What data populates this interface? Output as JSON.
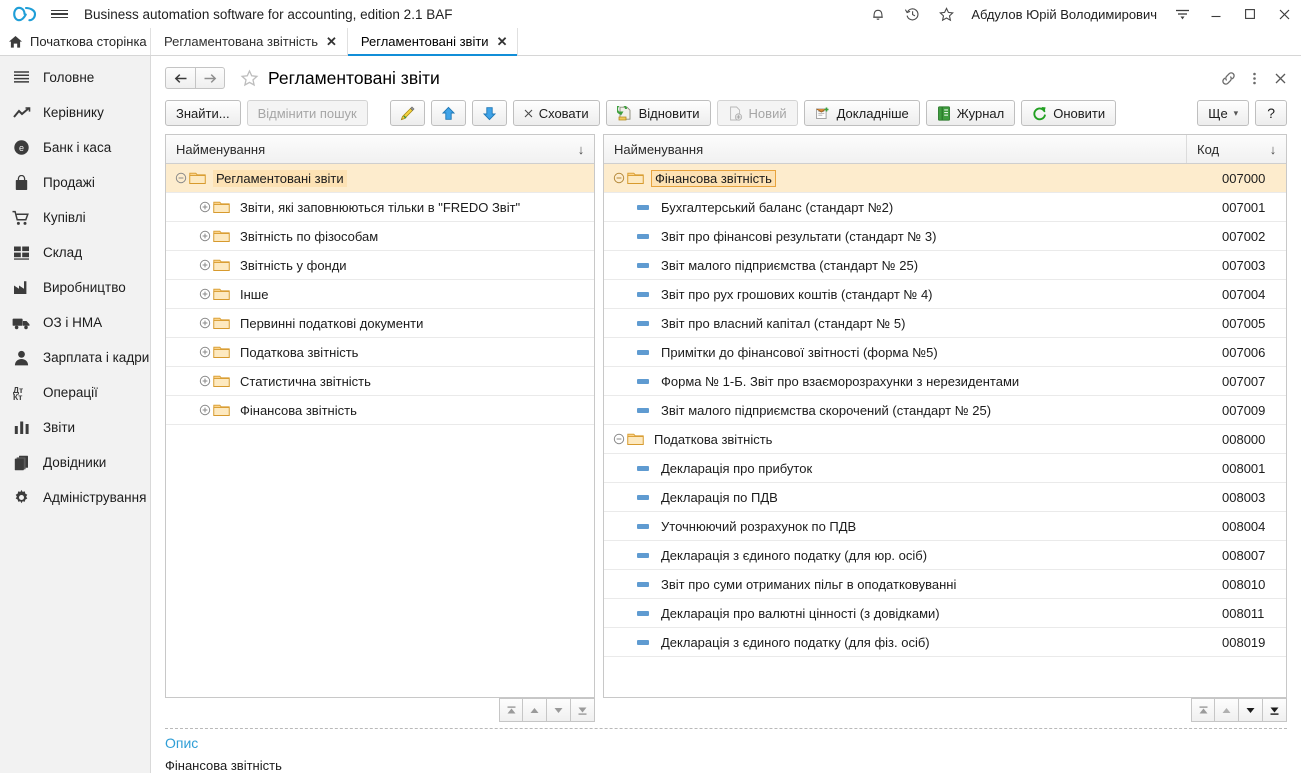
{
  "titlebar": {
    "logo_icon": "infinity-logo-icon",
    "menu_icon": "hamburger-menu-icon",
    "app_title": "Business automation software for accounting, edition 2.1 BAF",
    "notifications_icon": "bell-icon",
    "history_icon": "clock-history-icon",
    "favorites_icon": "star-icon",
    "user_name": "Абдулов Юрій Володимирович",
    "more_icon": "menu-lines-icon",
    "minimize_label": "—",
    "maximize_label": "□",
    "close_label": "✕"
  },
  "tabs": {
    "home_label": "Початкова сторінка",
    "home_icon": "home-icon",
    "items": [
      {
        "label": "Регламентована звітність",
        "active": false,
        "close": "✕"
      },
      {
        "label": "Регламентовані звіти",
        "active": true,
        "close": "✕"
      }
    ]
  },
  "sidebar": {
    "items": [
      {
        "label": "Головне",
        "icon": "lines-icon"
      },
      {
        "label": "Керівнику",
        "icon": "trend-line-icon"
      },
      {
        "label": "Банк і каса",
        "icon": "coin-icon"
      },
      {
        "label": "Продажі",
        "icon": "bag-icon"
      },
      {
        "label": "Купівлі",
        "icon": "shopping-cart-icon"
      },
      {
        "label": "Склад",
        "icon": "grid-blocks-icon"
      },
      {
        "label": "Виробництво",
        "icon": "factory-icon"
      },
      {
        "label": "ОЗ і НМА",
        "icon": "truck-icon"
      },
      {
        "label": "Зарплата і кадри",
        "icon": "person-icon"
      },
      {
        "label": "Операції",
        "icon": "debit-credit-icon"
      },
      {
        "label": "Звіти",
        "icon": "bar-chart-icon"
      },
      {
        "label": "Довідники",
        "icon": "books-icon"
      },
      {
        "label": "Адміністрування",
        "icon": "gear-icon"
      }
    ]
  },
  "form": {
    "back_icon": "arrow-left-icon",
    "forward_icon": "arrow-right-icon",
    "favorite_icon": "star-outline-icon",
    "title": "Регламентовані звіти",
    "link_icon": "link-icon",
    "kebab_icon": "vertical-dots-icon",
    "close_icon": "close-icon"
  },
  "commandbar": {
    "find_label": "Знайти...",
    "cancel_search_label": "Відмінити пошук",
    "edit_icon": "pencil-icon",
    "move_up_icon": "arrow-up-blue-icon",
    "move_down_icon": "arrow-down-blue-icon",
    "hide_label": "Сховати",
    "hide_icon": "close-small-icon",
    "restore_label": "Відновити",
    "restore_icon": "restore-icon",
    "new_label": "Новий",
    "new_icon": "new-document-icon",
    "details_label": "Докладніше",
    "details_icon": "details-document-icon",
    "journal_label": "Журнал",
    "journal_icon": "journal-book-icon",
    "refresh_label": "Оновити",
    "refresh_icon": "refresh-icon",
    "more_label": "Ще",
    "more_caret": "▾",
    "help_label": "?"
  },
  "left_panel": {
    "header_name": "Найменування",
    "sort_arrow": "↓",
    "rows": [
      {
        "label": "Регламентовані звіти",
        "level": 0,
        "node": "expanded",
        "type": "folder",
        "selected": true
      },
      {
        "label": "Звіти, які заповнюються тільки в \"FREDO Звіт\"",
        "level": 1,
        "node": "collapsed",
        "type": "folder",
        "selected": false
      },
      {
        "label": "Звітність по фізособам",
        "level": 1,
        "node": "collapsed",
        "type": "folder",
        "selected": false
      },
      {
        "label": "Звітність у фонди",
        "level": 1,
        "node": "collapsed",
        "type": "folder",
        "selected": false
      },
      {
        "label": "Інше",
        "level": 1,
        "node": "collapsed",
        "type": "folder",
        "selected": false
      },
      {
        "label": "Первинні податкові документи",
        "level": 1,
        "node": "collapsed",
        "type": "folder",
        "selected": false
      },
      {
        "label": "Податкова звітність",
        "level": 1,
        "node": "collapsed",
        "type": "folder",
        "selected": false
      },
      {
        "label": "Статистична звітність",
        "level": 1,
        "node": "collapsed",
        "type": "folder",
        "selected": false
      },
      {
        "label": "Фінансова звітність",
        "level": 1,
        "node": "collapsed",
        "type": "folder",
        "selected": false
      }
    ],
    "nav": [
      "first-icon",
      "up-icon",
      "down-icon",
      "last-icon"
    ]
  },
  "right_panel": {
    "header_name": "Найменування",
    "header_code": "Код",
    "sort_arrow": "↓",
    "rows": [
      {
        "label": "Фінансова звітність",
        "code": "007000",
        "level": 0,
        "node": "expanded",
        "type": "folder",
        "selected": true
      },
      {
        "label": "Бухгалтерський баланс (стандарт №2)",
        "code": "007001",
        "level": 1,
        "type": "item",
        "selected": false
      },
      {
        "label": "Звіт про фінансові результати (стандарт № 3)",
        "code": "007002",
        "level": 1,
        "type": "item",
        "selected": false
      },
      {
        "label": "Звіт малого підприємства (стандарт № 25)",
        "code": "007003",
        "level": 1,
        "type": "item",
        "selected": false
      },
      {
        "label": "Звіт про рух грошових коштів (стандарт № 4)",
        "code": "007004",
        "level": 1,
        "type": "item",
        "selected": false
      },
      {
        "label": "Звіт про власний капітал (стандарт № 5)",
        "code": "007005",
        "level": 1,
        "type": "item",
        "selected": false
      },
      {
        "label": "Примітки до фінансової звітності (форма №5)",
        "code": "007006",
        "level": 1,
        "type": "item",
        "selected": false
      },
      {
        "label": "Форма № 1-Б. Звіт про взаєморозрахунки з нерезидентами",
        "code": "007007",
        "level": 1,
        "type": "item",
        "selected": false
      },
      {
        "label": "Звіт малого підприємства скорочений (стандарт № 25)",
        "code": "007009",
        "level": 1,
        "type": "item",
        "selected": false
      },
      {
        "label": "Податкова звітність",
        "code": "008000",
        "level": 0,
        "node": "expanded",
        "type": "folder",
        "selected": false
      },
      {
        "label": "Декларація про прибуток",
        "code": "008001",
        "level": 1,
        "type": "item",
        "selected": false
      },
      {
        "label": "Декларація по ПДВ",
        "code": "008003",
        "level": 1,
        "type": "item",
        "selected": false
      },
      {
        "label": "Уточнюючий розрахунок по ПДВ",
        "code": "008004",
        "level": 1,
        "type": "item",
        "selected": false
      },
      {
        "label": "Декларація з єдиного податку (для юр. осіб)",
        "code": "008007",
        "level": 1,
        "type": "item",
        "selected": false
      },
      {
        "label": "Звіт про суми отриманих пільг в оподатковуванні",
        "code": "008010",
        "level": 1,
        "type": "item",
        "selected": false
      },
      {
        "label": "Декларація про валютні цінності (з довідками)",
        "code": "008011",
        "level": 1,
        "type": "item",
        "selected": false
      },
      {
        "label": "Декларація з єдиного податку (для фіз. осіб)",
        "code": "008019",
        "level": 1,
        "type": "item",
        "selected": false
      }
    ],
    "nav": [
      "first-icon",
      "up-icon",
      "down-icon",
      "last-icon"
    ]
  },
  "description": {
    "title": "Опис",
    "text": "Фінансова звітність"
  }
}
